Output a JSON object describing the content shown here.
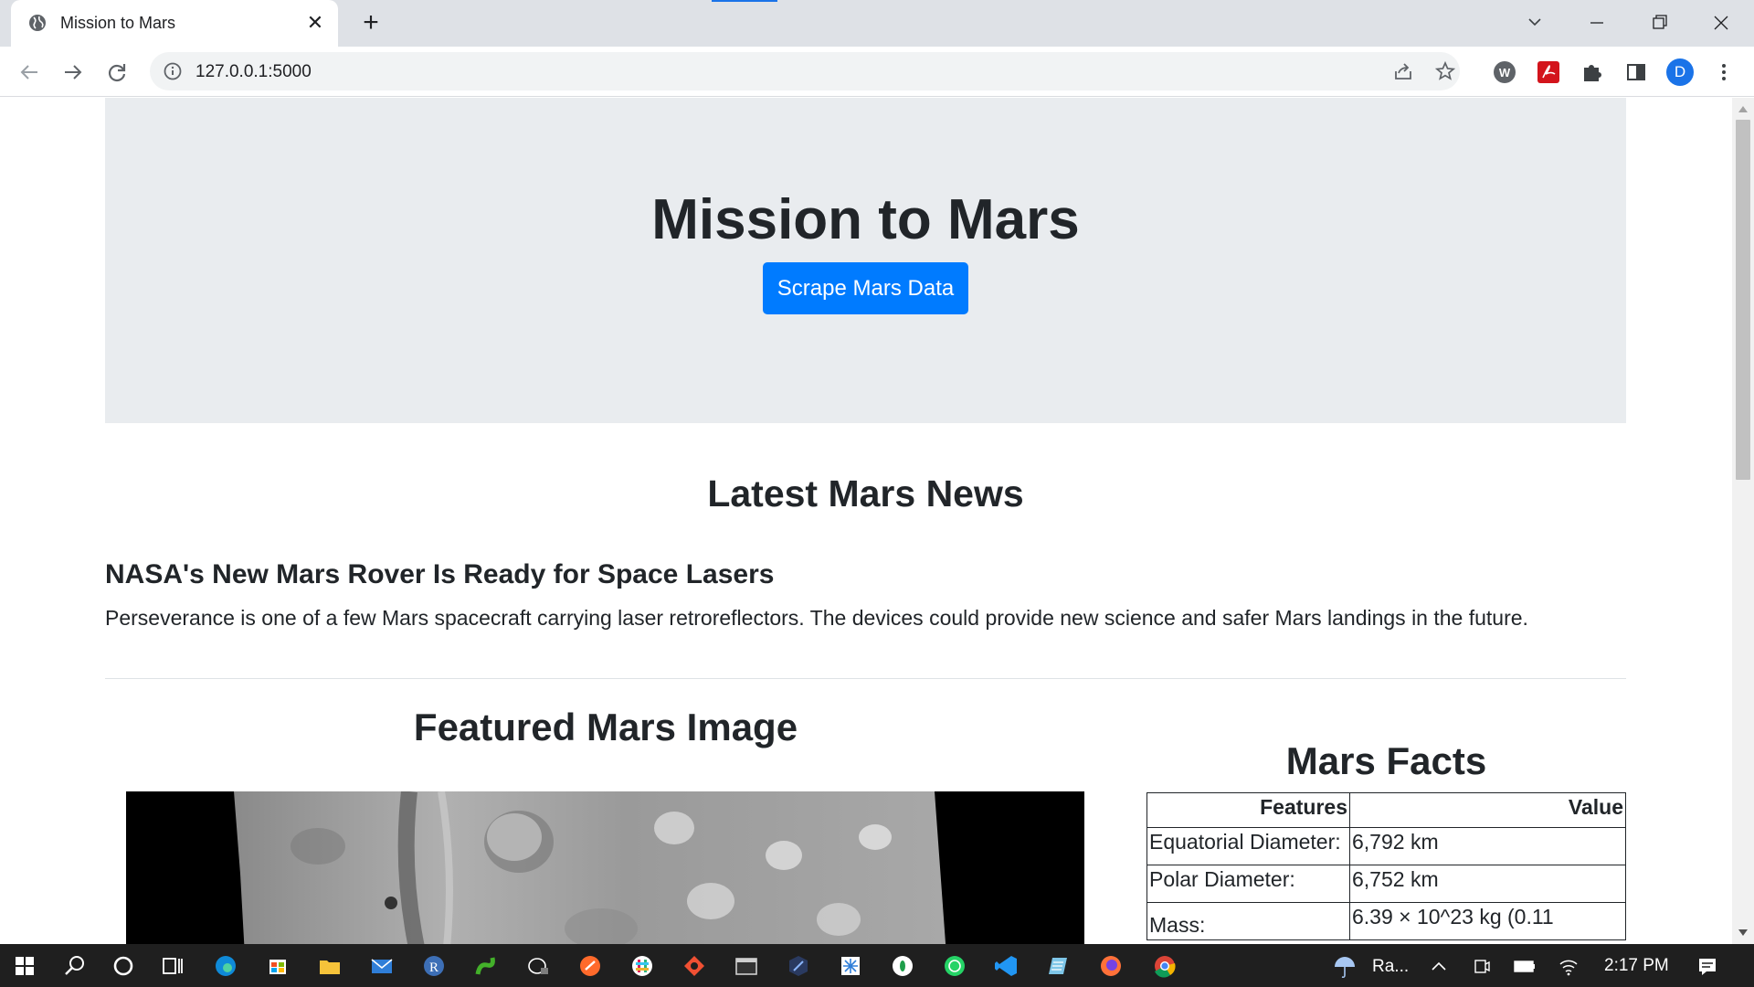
{
  "browser": {
    "tab_title": "Mission to Mars",
    "url": "127.0.0.1:5000",
    "profile_initial": "D",
    "extension_w_label": "W"
  },
  "page": {
    "title": "Mission to Mars",
    "scrape_button_label": "Scrape Mars Data",
    "news": {
      "heading": "Latest Mars News",
      "title": "NASA's New Mars Rover Is Ready for Space Lasers",
      "body": "Perseverance is one of a few Mars spacecraft carrying laser retroreflectors. The devices could provide new science and safer Mars landings in the future."
    },
    "featured_image_heading": "Featured Mars Image",
    "facts": {
      "heading": "Mars Facts",
      "columns": [
        "Features",
        "Value"
      ],
      "rows": [
        [
          "Equatorial Diameter:",
          "6,792 km"
        ],
        [
          "Polar Diameter:",
          "6,752 km"
        ],
        [
          "Mass:",
          "6.39 × 10^23 kg (0.11"
        ]
      ]
    }
  },
  "taskbar": {
    "weather_text": "Ra...",
    "clock": "2:17 PM"
  },
  "colors": {
    "primary_button": "#007bff",
    "jumbotron_bg": "#e9ecef",
    "taskbar_bg": "#1f1f1f"
  }
}
